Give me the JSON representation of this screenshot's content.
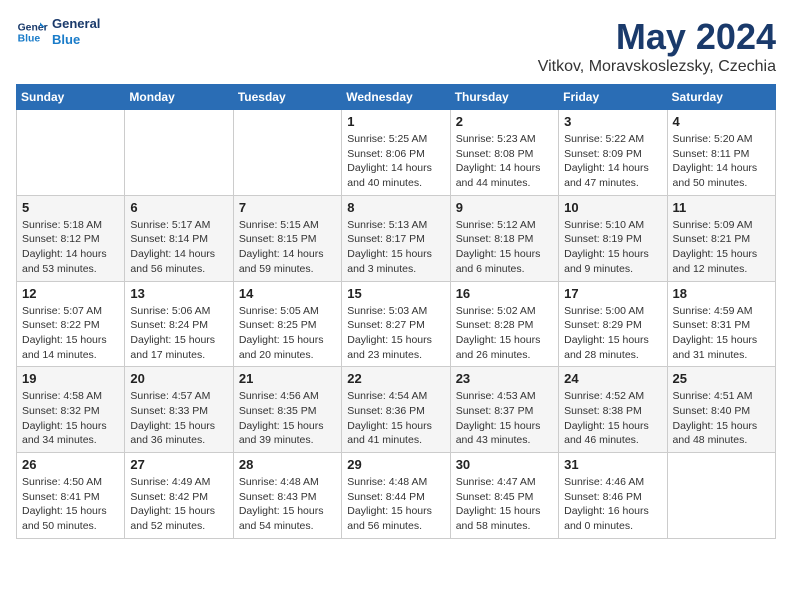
{
  "header": {
    "logo_line1": "General",
    "logo_line2": "Blue",
    "month": "May 2024",
    "location": "Vitkov, Moravskoslezsky, Czechia"
  },
  "weekdays": [
    "Sunday",
    "Monday",
    "Tuesday",
    "Wednesday",
    "Thursday",
    "Friday",
    "Saturday"
  ],
  "weeks": [
    [
      {
        "day": "",
        "sunrise": "",
        "sunset": "",
        "daylight": ""
      },
      {
        "day": "",
        "sunrise": "",
        "sunset": "",
        "daylight": ""
      },
      {
        "day": "",
        "sunrise": "",
        "sunset": "",
        "daylight": ""
      },
      {
        "day": "1",
        "sunrise": "Sunrise: 5:25 AM",
        "sunset": "Sunset: 8:06 PM",
        "daylight": "Daylight: 14 hours and 40 minutes."
      },
      {
        "day": "2",
        "sunrise": "Sunrise: 5:23 AM",
        "sunset": "Sunset: 8:08 PM",
        "daylight": "Daylight: 14 hours and 44 minutes."
      },
      {
        "day": "3",
        "sunrise": "Sunrise: 5:22 AM",
        "sunset": "Sunset: 8:09 PM",
        "daylight": "Daylight: 14 hours and 47 minutes."
      },
      {
        "day": "4",
        "sunrise": "Sunrise: 5:20 AM",
        "sunset": "Sunset: 8:11 PM",
        "daylight": "Daylight: 14 hours and 50 minutes."
      }
    ],
    [
      {
        "day": "5",
        "sunrise": "Sunrise: 5:18 AM",
        "sunset": "Sunset: 8:12 PM",
        "daylight": "Daylight: 14 hours and 53 minutes."
      },
      {
        "day": "6",
        "sunrise": "Sunrise: 5:17 AM",
        "sunset": "Sunset: 8:14 PM",
        "daylight": "Daylight: 14 hours and 56 minutes."
      },
      {
        "day": "7",
        "sunrise": "Sunrise: 5:15 AM",
        "sunset": "Sunset: 8:15 PM",
        "daylight": "Daylight: 14 hours and 59 minutes."
      },
      {
        "day": "8",
        "sunrise": "Sunrise: 5:13 AM",
        "sunset": "Sunset: 8:17 PM",
        "daylight": "Daylight: 15 hours and 3 minutes."
      },
      {
        "day": "9",
        "sunrise": "Sunrise: 5:12 AM",
        "sunset": "Sunset: 8:18 PM",
        "daylight": "Daylight: 15 hours and 6 minutes."
      },
      {
        "day": "10",
        "sunrise": "Sunrise: 5:10 AM",
        "sunset": "Sunset: 8:19 PM",
        "daylight": "Daylight: 15 hours and 9 minutes."
      },
      {
        "day": "11",
        "sunrise": "Sunrise: 5:09 AM",
        "sunset": "Sunset: 8:21 PM",
        "daylight": "Daylight: 15 hours and 12 minutes."
      }
    ],
    [
      {
        "day": "12",
        "sunrise": "Sunrise: 5:07 AM",
        "sunset": "Sunset: 8:22 PM",
        "daylight": "Daylight: 15 hours and 14 minutes."
      },
      {
        "day": "13",
        "sunrise": "Sunrise: 5:06 AM",
        "sunset": "Sunset: 8:24 PM",
        "daylight": "Daylight: 15 hours and 17 minutes."
      },
      {
        "day": "14",
        "sunrise": "Sunrise: 5:05 AM",
        "sunset": "Sunset: 8:25 PM",
        "daylight": "Daylight: 15 hours and 20 minutes."
      },
      {
        "day": "15",
        "sunrise": "Sunrise: 5:03 AM",
        "sunset": "Sunset: 8:27 PM",
        "daylight": "Daylight: 15 hours and 23 minutes."
      },
      {
        "day": "16",
        "sunrise": "Sunrise: 5:02 AM",
        "sunset": "Sunset: 8:28 PM",
        "daylight": "Daylight: 15 hours and 26 minutes."
      },
      {
        "day": "17",
        "sunrise": "Sunrise: 5:00 AM",
        "sunset": "Sunset: 8:29 PM",
        "daylight": "Daylight: 15 hours and 28 minutes."
      },
      {
        "day": "18",
        "sunrise": "Sunrise: 4:59 AM",
        "sunset": "Sunset: 8:31 PM",
        "daylight": "Daylight: 15 hours and 31 minutes."
      }
    ],
    [
      {
        "day": "19",
        "sunrise": "Sunrise: 4:58 AM",
        "sunset": "Sunset: 8:32 PM",
        "daylight": "Daylight: 15 hours and 34 minutes."
      },
      {
        "day": "20",
        "sunrise": "Sunrise: 4:57 AM",
        "sunset": "Sunset: 8:33 PM",
        "daylight": "Daylight: 15 hours and 36 minutes."
      },
      {
        "day": "21",
        "sunrise": "Sunrise: 4:56 AM",
        "sunset": "Sunset: 8:35 PM",
        "daylight": "Daylight: 15 hours and 39 minutes."
      },
      {
        "day": "22",
        "sunrise": "Sunrise: 4:54 AM",
        "sunset": "Sunset: 8:36 PM",
        "daylight": "Daylight: 15 hours and 41 minutes."
      },
      {
        "day": "23",
        "sunrise": "Sunrise: 4:53 AM",
        "sunset": "Sunset: 8:37 PM",
        "daylight": "Daylight: 15 hours and 43 minutes."
      },
      {
        "day": "24",
        "sunrise": "Sunrise: 4:52 AM",
        "sunset": "Sunset: 8:38 PM",
        "daylight": "Daylight: 15 hours and 46 minutes."
      },
      {
        "day": "25",
        "sunrise": "Sunrise: 4:51 AM",
        "sunset": "Sunset: 8:40 PM",
        "daylight": "Daylight: 15 hours and 48 minutes."
      }
    ],
    [
      {
        "day": "26",
        "sunrise": "Sunrise: 4:50 AM",
        "sunset": "Sunset: 8:41 PM",
        "daylight": "Daylight: 15 hours and 50 minutes."
      },
      {
        "day": "27",
        "sunrise": "Sunrise: 4:49 AM",
        "sunset": "Sunset: 8:42 PM",
        "daylight": "Daylight: 15 hours and 52 minutes."
      },
      {
        "day": "28",
        "sunrise": "Sunrise: 4:48 AM",
        "sunset": "Sunset: 8:43 PM",
        "daylight": "Daylight: 15 hours and 54 minutes."
      },
      {
        "day": "29",
        "sunrise": "Sunrise: 4:48 AM",
        "sunset": "Sunset: 8:44 PM",
        "daylight": "Daylight: 15 hours and 56 minutes."
      },
      {
        "day": "30",
        "sunrise": "Sunrise: 4:47 AM",
        "sunset": "Sunset: 8:45 PM",
        "daylight": "Daylight: 15 hours and 58 minutes."
      },
      {
        "day": "31",
        "sunrise": "Sunrise: 4:46 AM",
        "sunset": "Sunset: 8:46 PM",
        "daylight": "Daylight: 16 hours and 0 minutes."
      },
      {
        "day": "",
        "sunrise": "",
        "sunset": "",
        "daylight": ""
      }
    ]
  ]
}
